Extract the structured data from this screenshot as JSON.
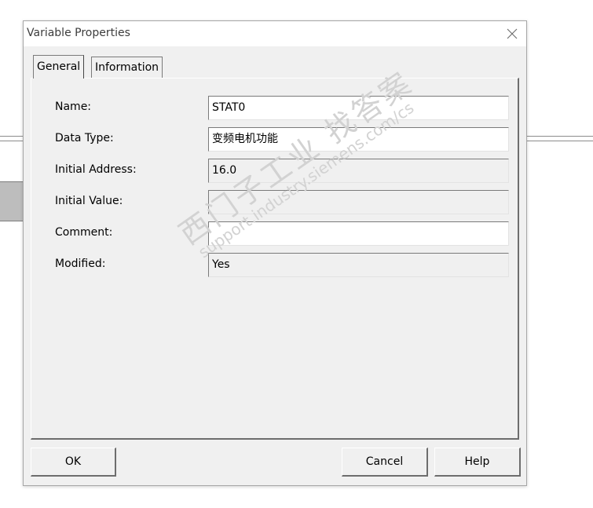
{
  "window": {
    "title": "Variable Properties",
    "close_icon": "close-icon"
  },
  "tabs": [
    {
      "label": "General",
      "active": true
    },
    {
      "label": "Information",
      "active": false
    }
  ],
  "fields": [
    {
      "label": "Name:",
      "value": "STAT0",
      "editable": true
    },
    {
      "label": "Data Type:",
      "value": "变频电机功能",
      "editable": true
    },
    {
      "label": "Initial Address:",
      "value": "16.0",
      "editable": false
    },
    {
      "label": "Initial Value:",
      "value": "",
      "editable": false
    },
    {
      "label": "Comment:",
      "value": "",
      "editable": true
    },
    {
      "label": "Modified:",
      "value": "Yes",
      "editable": false
    }
  ],
  "watermark": {
    "text": "西门子工业 找答案",
    "url": "support.industry.siemens.com/cs"
  },
  "buttons": {
    "ok": "OK",
    "cancel": "Cancel",
    "help": "Help"
  }
}
